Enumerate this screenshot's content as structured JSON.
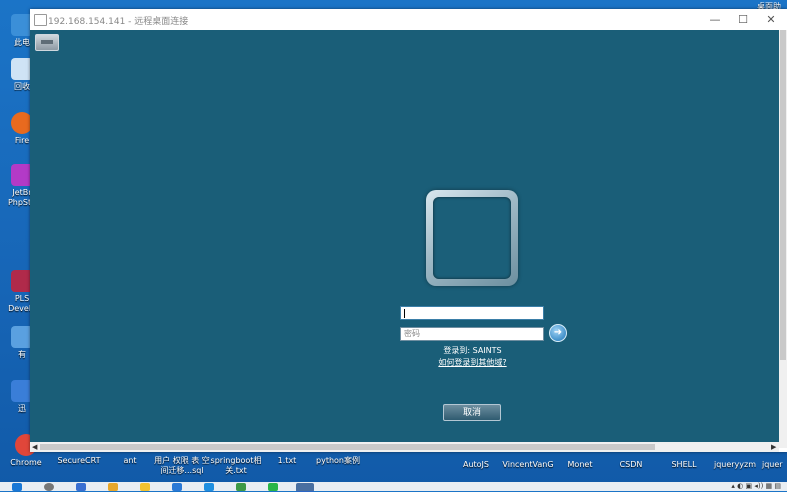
{
  "window": {
    "title": "192.168.154.141 - 远程桌面连接",
    "minimize": "—",
    "maximize": "☐",
    "close": "✕"
  },
  "login": {
    "username_value": "",
    "password_placeholder": "密码",
    "logon_to": "登录到: SAINTS",
    "other_domain_link": "如何登录到其他域?",
    "cancel": "取消",
    "go_glyph": "➜"
  },
  "desktop_left_icons": [
    {
      "label": "此电",
      "color": "#3b8fd8"
    },
    {
      "label": "回收",
      "color": "#cfe3f5"
    },
    {
      "label": "Fire",
      "color": "#e86a1f"
    },
    {
      "label": "JetBr PhpSto",
      "color": "#b33ac7"
    },
    {
      "label": "PLS Develo",
      "color": "#b02a4a"
    },
    {
      "label": "有",
      "color": "#5aa0e0"
    },
    {
      "label": "迅",
      "color": "#3a7ed8"
    },
    {
      "label": "Chrome",
      "color": "#e0463a"
    }
  ],
  "desktop_bottom_labels": [
    "SecureCRT",
    "ant",
    "用户 权限 表 空间迁移...sql",
    "springboot相 关.txt",
    "1.txt",
    "python案例",
    "AutoJS",
    "VincentVanG",
    "Monet",
    "CSDN",
    "SHELL",
    "jqueryyzm",
    "jquer"
  ],
  "desktop_right_label": "桌面助手",
  "colors": {
    "session_bg": "#1a5e78",
    "desktop_bg": "#1766b7"
  }
}
